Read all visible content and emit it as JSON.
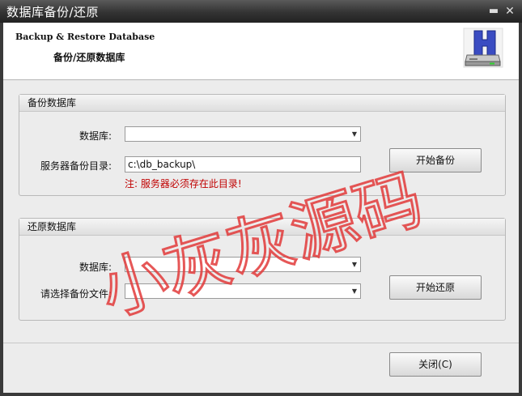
{
  "window": {
    "title": "数据库备份/还原",
    "minimize_glyph": "▬",
    "close_glyph": "✕"
  },
  "header": {
    "title_en": "Backup & Restore Database",
    "title_cn": "备份/还原数据库",
    "logo_icon": "database-backup-icon"
  },
  "backup": {
    "group_title": "备份数据库",
    "db_label": "数据库:",
    "db_value": "",
    "dir_label": "服务器备份目录:",
    "dir_value": "c:\\db_backup\\",
    "warning": "注: 服务器必须存在此目录!",
    "start_button": "开始备份"
  },
  "restore": {
    "group_title": "还原数据库",
    "db_label": "数据库:",
    "db_value": "",
    "file_label": "请选择备份文件:",
    "file_value": "",
    "start_button": "开始还原"
  },
  "footer": {
    "close_button": "关闭(C)"
  },
  "watermark": {
    "text": "小灰灰源码",
    "color": "#e23a3a"
  }
}
